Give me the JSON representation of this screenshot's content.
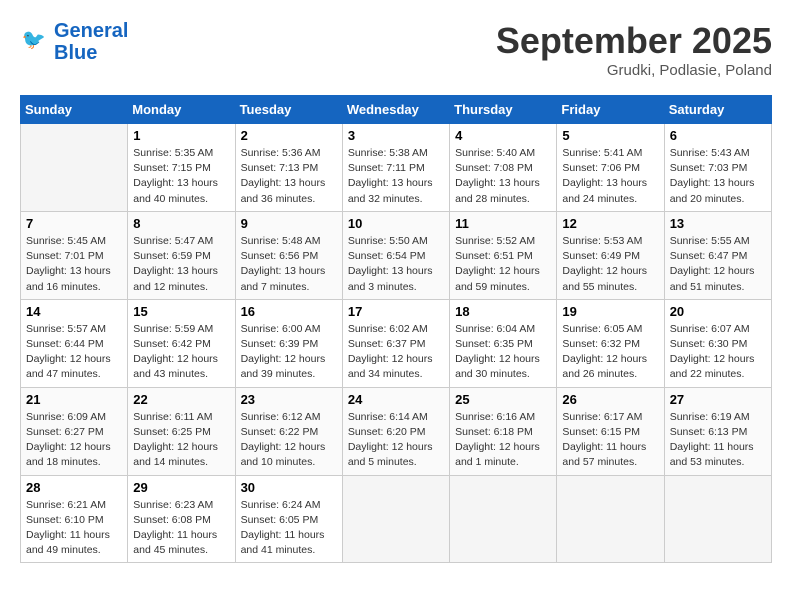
{
  "header": {
    "logo_line1": "General",
    "logo_line2": "Blue",
    "month": "September 2025",
    "location": "Grudki, Podlasie, Poland"
  },
  "weekdays": [
    "Sunday",
    "Monday",
    "Tuesday",
    "Wednesday",
    "Thursday",
    "Friday",
    "Saturday"
  ],
  "weeks": [
    [
      {
        "day": "",
        "info": ""
      },
      {
        "day": "1",
        "info": "Sunrise: 5:35 AM\nSunset: 7:15 PM\nDaylight: 13 hours\nand 40 minutes."
      },
      {
        "day": "2",
        "info": "Sunrise: 5:36 AM\nSunset: 7:13 PM\nDaylight: 13 hours\nand 36 minutes."
      },
      {
        "day": "3",
        "info": "Sunrise: 5:38 AM\nSunset: 7:11 PM\nDaylight: 13 hours\nand 32 minutes."
      },
      {
        "day": "4",
        "info": "Sunrise: 5:40 AM\nSunset: 7:08 PM\nDaylight: 13 hours\nand 28 minutes."
      },
      {
        "day": "5",
        "info": "Sunrise: 5:41 AM\nSunset: 7:06 PM\nDaylight: 13 hours\nand 24 minutes."
      },
      {
        "day": "6",
        "info": "Sunrise: 5:43 AM\nSunset: 7:03 PM\nDaylight: 13 hours\nand 20 minutes."
      }
    ],
    [
      {
        "day": "7",
        "info": "Sunrise: 5:45 AM\nSunset: 7:01 PM\nDaylight: 13 hours\nand 16 minutes."
      },
      {
        "day": "8",
        "info": "Sunrise: 5:47 AM\nSunset: 6:59 PM\nDaylight: 13 hours\nand 12 minutes."
      },
      {
        "day": "9",
        "info": "Sunrise: 5:48 AM\nSunset: 6:56 PM\nDaylight: 13 hours\nand 7 minutes."
      },
      {
        "day": "10",
        "info": "Sunrise: 5:50 AM\nSunset: 6:54 PM\nDaylight: 13 hours\nand 3 minutes."
      },
      {
        "day": "11",
        "info": "Sunrise: 5:52 AM\nSunset: 6:51 PM\nDaylight: 12 hours\nand 59 minutes."
      },
      {
        "day": "12",
        "info": "Sunrise: 5:53 AM\nSunset: 6:49 PM\nDaylight: 12 hours\nand 55 minutes."
      },
      {
        "day": "13",
        "info": "Sunrise: 5:55 AM\nSunset: 6:47 PM\nDaylight: 12 hours\nand 51 minutes."
      }
    ],
    [
      {
        "day": "14",
        "info": "Sunrise: 5:57 AM\nSunset: 6:44 PM\nDaylight: 12 hours\nand 47 minutes."
      },
      {
        "day": "15",
        "info": "Sunrise: 5:59 AM\nSunset: 6:42 PM\nDaylight: 12 hours\nand 43 minutes."
      },
      {
        "day": "16",
        "info": "Sunrise: 6:00 AM\nSunset: 6:39 PM\nDaylight: 12 hours\nand 39 minutes."
      },
      {
        "day": "17",
        "info": "Sunrise: 6:02 AM\nSunset: 6:37 PM\nDaylight: 12 hours\nand 34 minutes."
      },
      {
        "day": "18",
        "info": "Sunrise: 6:04 AM\nSunset: 6:35 PM\nDaylight: 12 hours\nand 30 minutes."
      },
      {
        "day": "19",
        "info": "Sunrise: 6:05 AM\nSunset: 6:32 PM\nDaylight: 12 hours\nand 26 minutes."
      },
      {
        "day": "20",
        "info": "Sunrise: 6:07 AM\nSunset: 6:30 PM\nDaylight: 12 hours\nand 22 minutes."
      }
    ],
    [
      {
        "day": "21",
        "info": "Sunrise: 6:09 AM\nSunset: 6:27 PM\nDaylight: 12 hours\nand 18 minutes."
      },
      {
        "day": "22",
        "info": "Sunrise: 6:11 AM\nSunset: 6:25 PM\nDaylight: 12 hours\nand 14 minutes."
      },
      {
        "day": "23",
        "info": "Sunrise: 6:12 AM\nSunset: 6:22 PM\nDaylight: 12 hours\nand 10 minutes."
      },
      {
        "day": "24",
        "info": "Sunrise: 6:14 AM\nSunset: 6:20 PM\nDaylight: 12 hours\nand 5 minutes."
      },
      {
        "day": "25",
        "info": "Sunrise: 6:16 AM\nSunset: 6:18 PM\nDaylight: 12 hours\nand 1 minute."
      },
      {
        "day": "26",
        "info": "Sunrise: 6:17 AM\nSunset: 6:15 PM\nDaylight: 11 hours\nand 57 minutes."
      },
      {
        "day": "27",
        "info": "Sunrise: 6:19 AM\nSunset: 6:13 PM\nDaylight: 11 hours\nand 53 minutes."
      }
    ],
    [
      {
        "day": "28",
        "info": "Sunrise: 6:21 AM\nSunset: 6:10 PM\nDaylight: 11 hours\nand 49 minutes."
      },
      {
        "day": "29",
        "info": "Sunrise: 6:23 AM\nSunset: 6:08 PM\nDaylight: 11 hours\nand 45 minutes."
      },
      {
        "day": "30",
        "info": "Sunrise: 6:24 AM\nSunset: 6:05 PM\nDaylight: 11 hours\nand 41 minutes."
      },
      {
        "day": "",
        "info": ""
      },
      {
        "day": "",
        "info": ""
      },
      {
        "day": "",
        "info": ""
      },
      {
        "day": "",
        "info": ""
      }
    ]
  ]
}
